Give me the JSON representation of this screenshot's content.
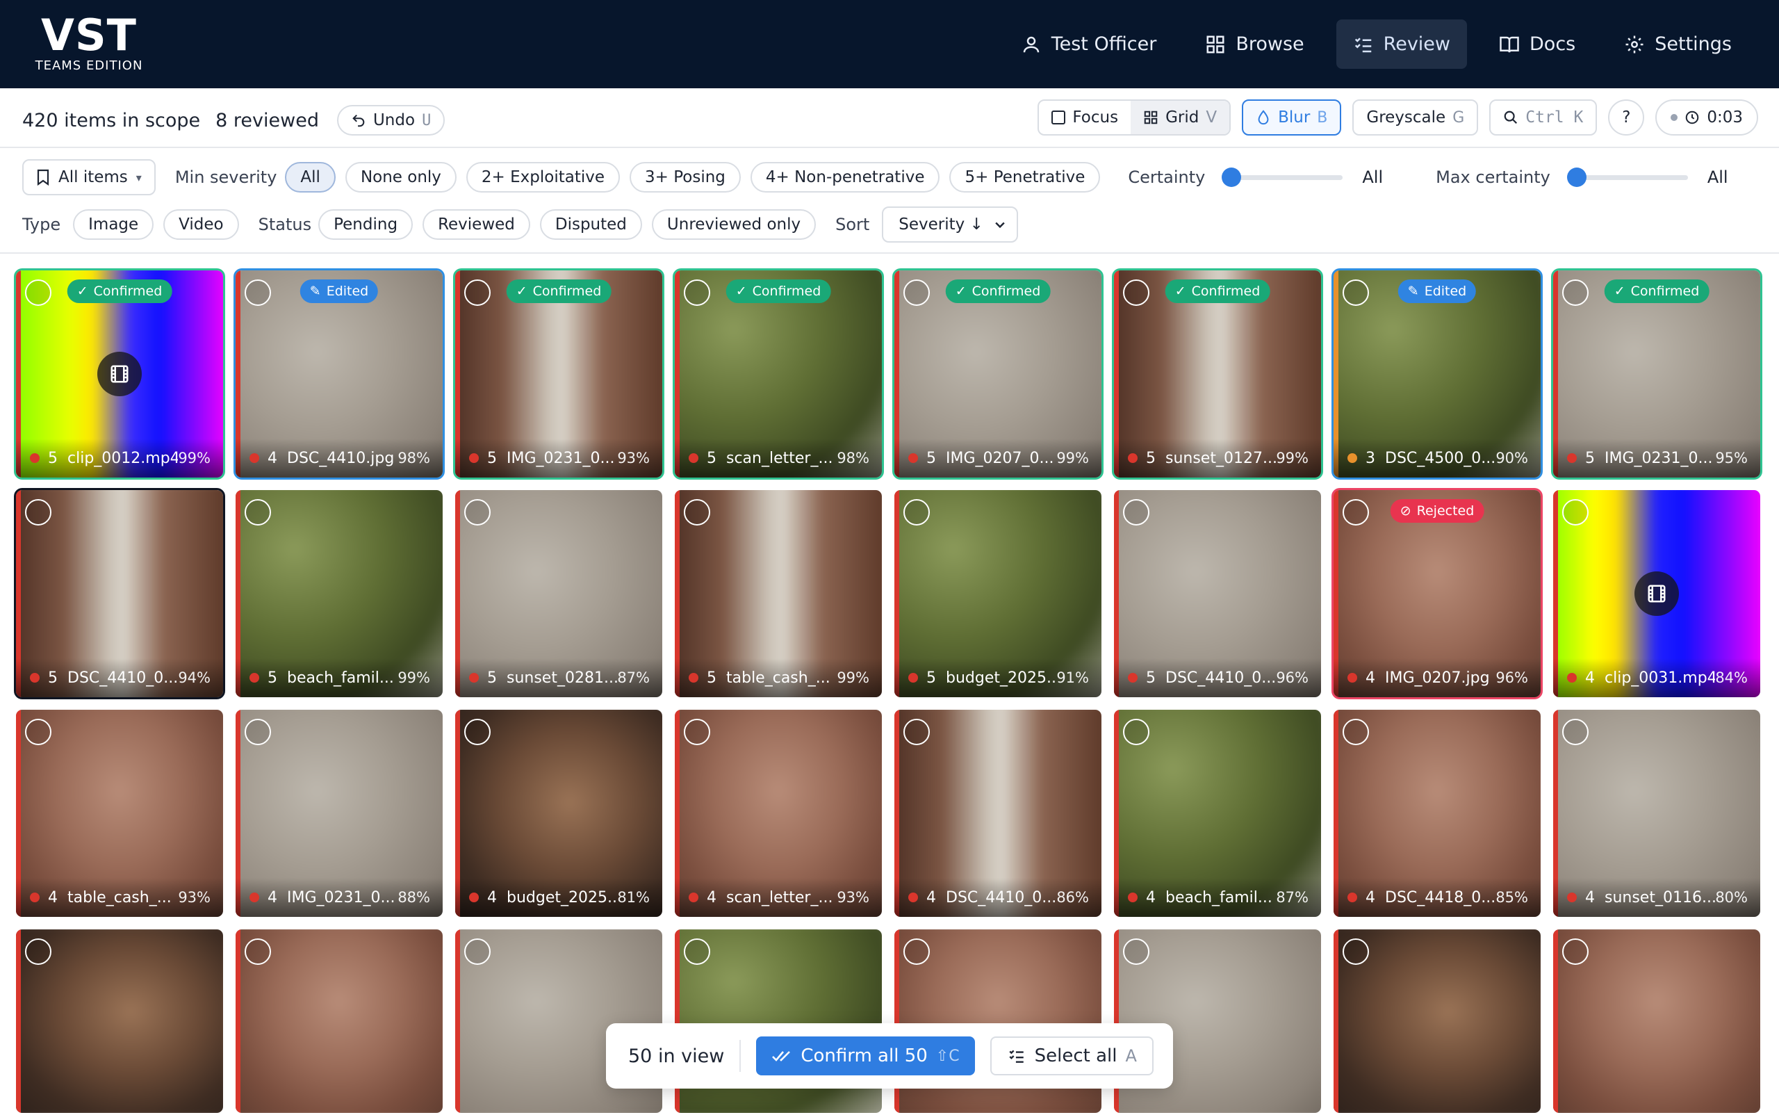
{
  "app": {
    "logo": "VST",
    "edition": "TEAMS EDITION"
  },
  "nav": [
    {
      "label": "Test Officer",
      "icon": "user-icon",
      "active": false
    },
    {
      "label": "Browse",
      "icon": "grid-icon",
      "active": false
    },
    {
      "label": "Review",
      "icon": "checklist-icon",
      "active": true
    },
    {
      "label": "Docs",
      "icon": "book-icon",
      "active": false
    },
    {
      "label": "Settings",
      "icon": "gear-icon",
      "active": false
    }
  ],
  "toolbar": {
    "scope": "420 items in scope",
    "reviewed": "8 reviewed",
    "undo": "Undo",
    "undo_key": "U",
    "focus": "Focus",
    "grid": "Grid",
    "grid_key": "V",
    "blur": "Blur",
    "blur_key": "B",
    "greyscale": "Greyscale",
    "greyscale_key": "G",
    "search_key": "Ctrl K",
    "help": "?",
    "timer": "0:03"
  },
  "filters": {
    "all_items": "All items",
    "min_severity_label": "Min severity",
    "severity_chips": [
      "All",
      "None only",
      "2+ Exploitative",
      "3+ Posing",
      "4+ Non-penetrative",
      "5+ Penetrative"
    ],
    "certainty_label": "Certainty",
    "certainty_value": "All",
    "max_certainty_label": "Max certainty",
    "max_certainty_value": "All",
    "type_label": "Type",
    "type_chips": [
      "Image",
      "Video"
    ],
    "status_label": "Status",
    "status_chips": [
      "Pending",
      "Reviewed",
      "Disputed",
      "Unreviewed only"
    ],
    "sort_label": "Sort",
    "sort_value": "Severity ↓"
  },
  "tiles": [
    {
      "sev": "5",
      "name": "clip_0012.mp4",
      "pct": "99%",
      "status": "confirmed",
      "badge": "Confirmed",
      "video": true,
      "bg": "rainbow"
    },
    {
      "sev": "4",
      "name": "DSC_4410.jpg",
      "pct": "98%",
      "status": "edited",
      "badge": "Edited",
      "bg": "grey"
    },
    {
      "sev": "5",
      "name": "IMG_0231_0...",
      "pct": "93%",
      "status": "confirmed",
      "badge": "Confirmed",
      "bg": "brown"
    },
    {
      "sev": "5",
      "name": "scan_letter_...",
      "pct": "98%",
      "status": "confirmed",
      "badge": "Confirmed",
      "bg": "green"
    },
    {
      "sev": "5",
      "name": "IMG_0207_0...",
      "pct": "99%",
      "status": "confirmed",
      "badge": "Confirmed",
      "bg": "grey"
    },
    {
      "sev": "5",
      "name": "sunset_0127....",
      "pct": "99%",
      "status": "confirmed",
      "badge": "Confirmed",
      "bg": "brown"
    },
    {
      "sev": "3",
      "name": "DSC_4500_0...",
      "pct": "90%",
      "status": "edited",
      "badge": "Edited",
      "bg": "green",
      "dot": "orange"
    },
    {
      "sev": "5",
      "name": "IMG_0231_0...",
      "pct": "95%",
      "status": "confirmed",
      "badge": "Confirmed",
      "bg": "grey"
    },
    {
      "sev": "5",
      "name": "DSC_4410_0...",
      "pct": "94%",
      "status": "focused",
      "bg": "brown"
    },
    {
      "sev": "5",
      "name": "beach_famil...",
      "pct": "99%",
      "status": "",
      "bg": "green"
    },
    {
      "sev": "5",
      "name": "sunset_0281....",
      "pct": "87%",
      "status": "",
      "bg": "grey"
    },
    {
      "sev": "5",
      "name": "table_cash_...",
      "pct": "99%",
      "status": "",
      "bg": "brown"
    },
    {
      "sev": "5",
      "name": "budget_2025...",
      "pct": "91%",
      "status": "",
      "bg": "green"
    },
    {
      "sev": "5",
      "name": "DSC_4410_0...",
      "pct": "96%",
      "status": "",
      "bg": "grey"
    },
    {
      "sev": "4",
      "name": "IMG_0207.jpg",
      "pct": "96%",
      "status": "rejected",
      "badge": "Rejected",
      "bg": "skin"
    },
    {
      "sev": "4",
      "name": "clip_0031.mp4",
      "pct": "84%",
      "status": "",
      "video": true,
      "bg": "rainbow2"
    },
    {
      "sev": "4",
      "name": "table_cash_...",
      "pct": "93%",
      "status": "",
      "bg": "skin"
    },
    {
      "sev": "4",
      "name": "IMG_0231_0...",
      "pct": "88%",
      "status": "",
      "bg": "grey"
    },
    {
      "sev": "4",
      "name": "budget_2025...",
      "pct": "81%",
      "status": "",
      "bg": "dark"
    },
    {
      "sev": "4",
      "name": "scan_letter_...",
      "pct": "93%",
      "status": "",
      "bg": "skin"
    },
    {
      "sev": "4",
      "name": "DSC_4410_0...",
      "pct": "86%",
      "status": "",
      "bg": "brown"
    },
    {
      "sev": "4",
      "name": "beach_famil...",
      "pct": "87%",
      "status": "",
      "bg": "green"
    },
    {
      "sev": "4",
      "name": "DSC_4418_0...",
      "pct": "85%",
      "status": "",
      "bg": "skin"
    },
    {
      "sev": "4",
      "name": "sunset_0116....",
      "pct": "80%",
      "status": "",
      "bg": "grey"
    },
    {
      "sev": "",
      "name": "",
      "pct": "",
      "status": "",
      "bg": "dark"
    },
    {
      "sev": "",
      "name": "",
      "pct": "",
      "status": "",
      "bg": "skin"
    },
    {
      "sev": "",
      "name": "",
      "pct": "",
      "status": "",
      "bg": "grey"
    },
    {
      "sev": "",
      "name": "",
      "pct": "",
      "status": "",
      "bg": "green"
    },
    {
      "sev": "",
      "name": "",
      "pct": "",
      "status": "",
      "bg": "skin"
    },
    {
      "sev": "",
      "name": "",
      "pct": "",
      "status": "",
      "bg": "grey"
    },
    {
      "sev": "",
      "name": "",
      "pct": "",
      "status": "",
      "bg": "dark"
    },
    {
      "sev": "",
      "name": "",
      "pct": "",
      "status": "",
      "bg": "skin"
    }
  ],
  "bulk": {
    "count": "50 in view",
    "confirm": "Confirm all 50",
    "confirm_key": "⇧C",
    "select_all": "Select all",
    "select_key": "A"
  },
  "colors": {
    "topbar": "#07162c",
    "accent": "#2f7de1",
    "confirmed": "#2fc391",
    "edited": "#2f8fe1",
    "rejected": "#ec4565",
    "severity_red": "#d9362c",
    "severity_orange": "#e8912c"
  }
}
